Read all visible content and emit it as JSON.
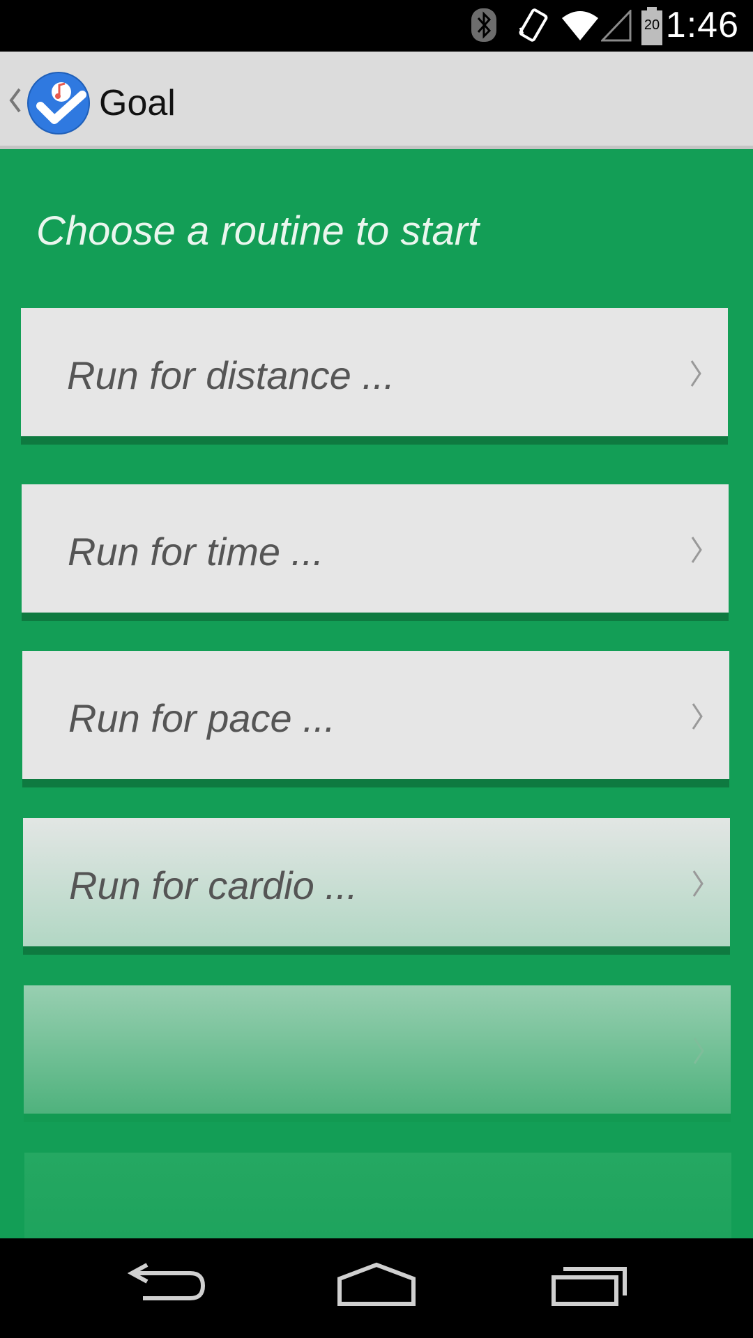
{
  "status_bar": {
    "time": "1:46",
    "battery_level": "20",
    "icons": [
      "bluetooth-icon",
      "vibrate-icon",
      "wifi-icon",
      "cell-signal-icon",
      "battery-icon"
    ]
  },
  "action_bar": {
    "title": "Goal",
    "icons": [
      "up-chevron-icon",
      "app-logo-icon"
    ]
  },
  "main": {
    "heading": "Choose a routine to start",
    "routines": [
      {
        "label": "Run for distance ..."
      },
      {
        "label": "Run for time ..."
      },
      {
        "label": "Run for pace ..."
      },
      {
        "label": "Run for cardio ..."
      },
      {
        "label": ""
      },
      {
        "label": ""
      }
    ]
  },
  "nav_bar": {
    "buttons": [
      "back-icon",
      "home-icon",
      "recent-apps-icon"
    ]
  },
  "colors": {
    "content_background": "#139e56",
    "card_background": "#e6e6e6",
    "card_shadow": "#0e7a40",
    "action_bar": "#dcdcdc",
    "logo_blue": "#2f79e0",
    "logo_red": "#e85a4f"
  }
}
